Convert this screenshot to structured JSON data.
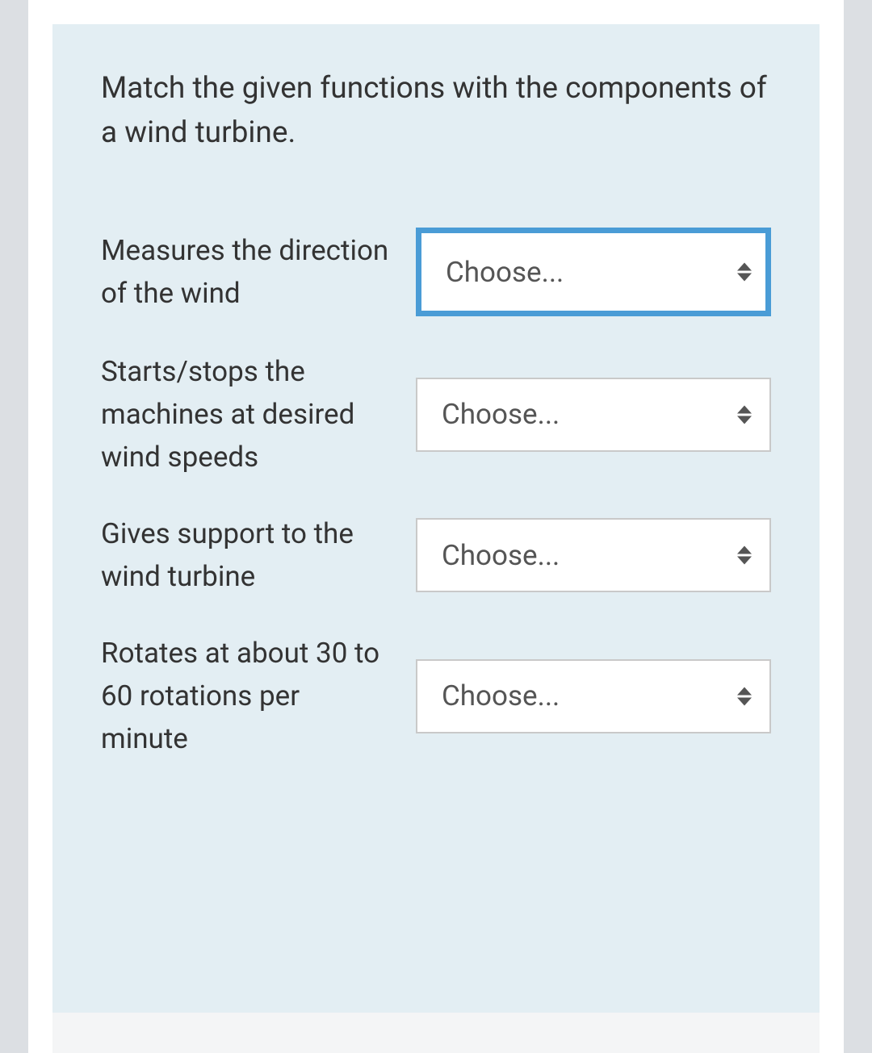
{
  "question": {
    "prompt": "Match the given functions with the components of a wind turbine.",
    "items": [
      {
        "text": "Measures the direction of the wind",
        "selected": "Choose...",
        "focused": true
      },
      {
        "text": "Starts/stops the machines at desired wind speeds",
        "selected": "Choose...",
        "focused": false
      },
      {
        "text": "Gives support to the wind turbine",
        "selected": "Choose...",
        "focused": false
      },
      {
        "text": "Rotates at about 30 to 60 rotations per minute",
        "selected": "Choose...",
        "focused": false
      }
    ]
  }
}
